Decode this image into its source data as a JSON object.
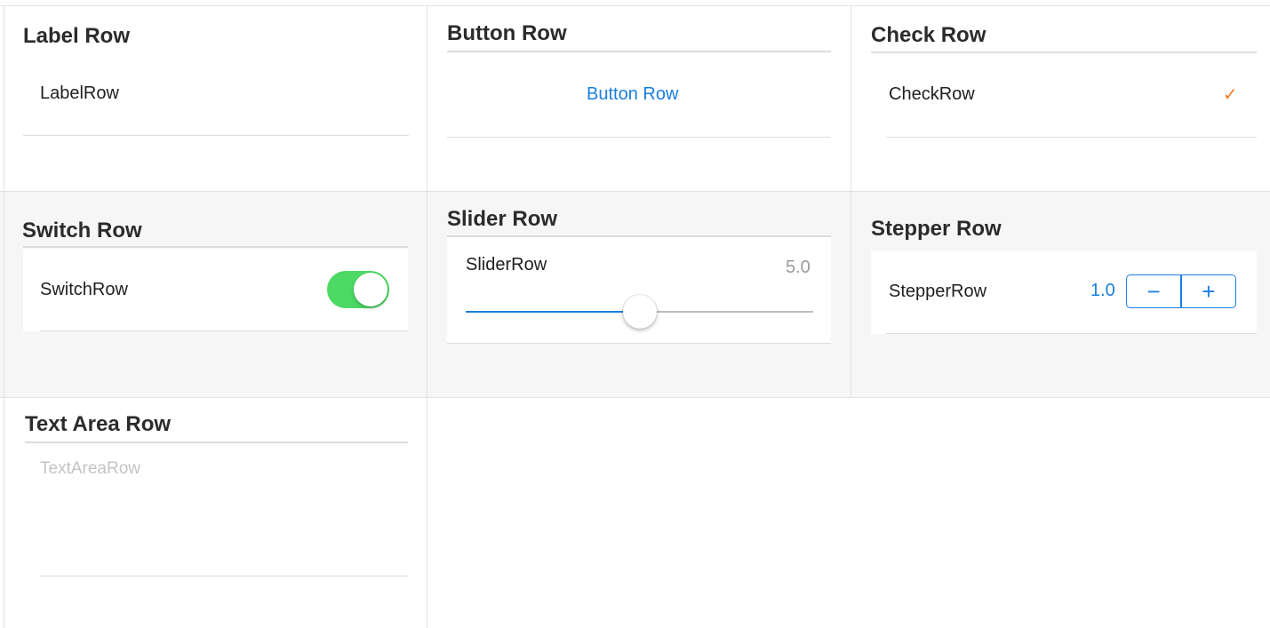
{
  "sections": {
    "label": {
      "title": "Label Row",
      "row_text": "LabelRow"
    },
    "button": {
      "title": "Button Row",
      "button_label": "Button Row"
    },
    "check": {
      "title": "Check Row",
      "row_text": "CheckRow",
      "checked": true,
      "check_glyph": "✓",
      "accent": "#ef7d2a"
    },
    "switch": {
      "title": "Switch Row",
      "row_text": "SwitchRow",
      "on": true,
      "on_color": "#4cd964"
    },
    "slider": {
      "title": "Slider Row",
      "row_text": "SliderRow",
      "value": "5.0",
      "min": 0,
      "max": 10,
      "fraction": 0.5,
      "tint": "#1a7ee0"
    },
    "stepper": {
      "title": "Stepper Row",
      "row_text": "StepperRow",
      "value": "1.0",
      "minus_glyph": "−",
      "plus_glyph": "+"
    },
    "textarea": {
      "title": "Text Area Row",
      "placeholder": "TextAreaRow"
    }
  }
}
